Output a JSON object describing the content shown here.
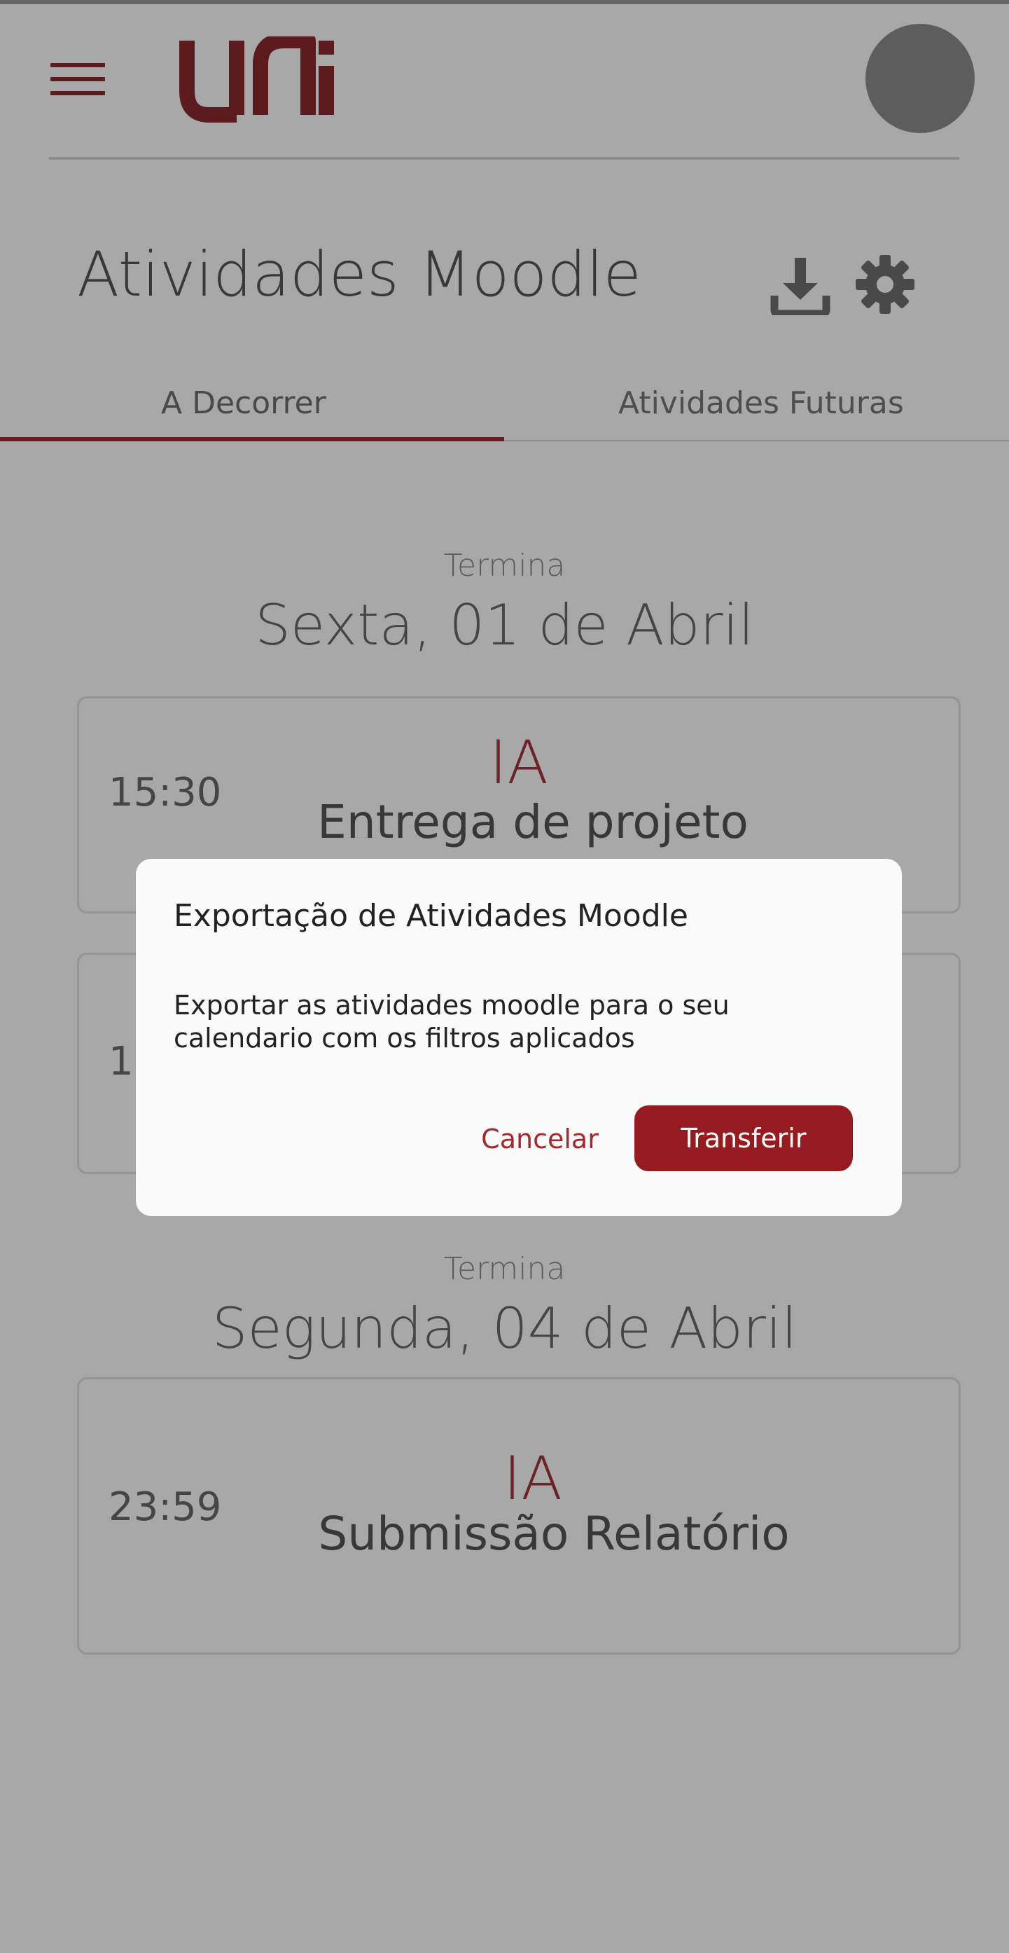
{
  "header": {
    "menu_icon": "hamburger-menu-icon",
    "logo_text": "uni",
    "avatar": "user-avatar"
  },
  "page": {
    "title": "Atividades Moodle",
    "download_icon": "download-icon",
    "settings_icon": "gear-icon"
  },
  "tabs": [
    {
      "label": "A Decorrer",
      "active": true
    },
    {
      "label": "Atividades Futuras",
      "active": false
    }
  ],
  "groups": [
    {
      "ends_label": "Termina",
      "date": "Sexta, 01 de Abril",
      "activities": [
        {
          "time": "15:30",
          "course": "IA",
          "title": "Entrega de projeto"
        },
        {
          "time": "17",
          "course": "",
          "title": ""
        }
      ]
    },
    {
      "ends_label": "Termina",
      "date": "Segunda, 04 de Abril",
      "activities": [
        {
          "time": "23:59",
          "course": "IA",
          "title": "Submissão Relatório"
        }
      ]
    }
  ],
  "dialog": {
    "title": "Exportação de Atividades Moodle",
    "body": "Exportar as atividades moodle para o seu calendario com os filtros aplicados",
    "cancel_label": "Cancelar",
    "confirm_label": "Transferir"
  },
  "colors": {
    "brand": "#a12a2f",
    "button_primary": "#951b20",
    "dialog_bg": "#fafafa",
    "scrim": "rgba(0,0,0,0.34)"
  }
}
